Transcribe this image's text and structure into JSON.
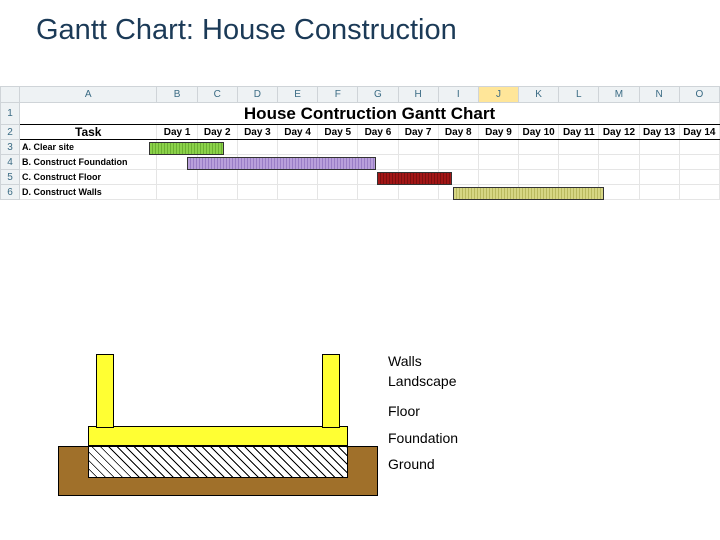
{
  "slide_title": "Gantt Chart: House Construction",
  "chart_title": "House Contruction Gantt Chart",
  "columns": [
    "A",
    "B",
    "C",
    "D",
    "E",
    "F",
    "G",
    "H",
    "I",
    "J",
    "K",
    "L",
    "M",
    "N",
    "O"
  ],
  "rows": [
    "1",
    "2",
    "3",
    "4",
    "5",
    "6"
  ],
  "task_header": "Task",
  "day_headers": [
    "Day 1",
    "Day 2",
    "Day 3",
    "Day 4",
    "Day 5",
    "Day 6",
    "Day 7",
    "Day 8",
    "Day 9",
    "Day 10",
    "Day 11",
    "Day 12",
    "Day 13",
    "Day 14"
  ],
  "tasks": [
    "A. Clear site",
    "B. Construct Foundation",
    "C. Construct Floor",
    "D. Construct Walls"
  ],
  "diagram_labels": {
    "walls": "Walls",
    "landscape": "Landscape",
    "floor": "Floor",
    "foundation": "Foundation",
    "ground": "Ground"
  },
  "selected_column": "J",
  "chart_data": {
    "type": "bar",
    "title": "House Contruction Gantt Chart",
    "xlabel": "Day",
    "ylabel": "Task",
    "x_range": [
      1,
      14
    ],
    "series": [
      {
        "name": "A. Clear site",
        "start": 1,
        "end": 2,
        "color": "green"
      },
      {
        "name": "B. Construct Foundation",
        "start": 2,
        "end": 6,
        "color": "purple"
      },
      {
        "name": "C. Construct Floor",
        "start": 7,
        "end": 8,
        "color": "red"
      },
      {
        "name": "D. Construct Walls",
        "start": 9,
        "end": 12,
        "color": "olive"
      }
    ]
  }
}
